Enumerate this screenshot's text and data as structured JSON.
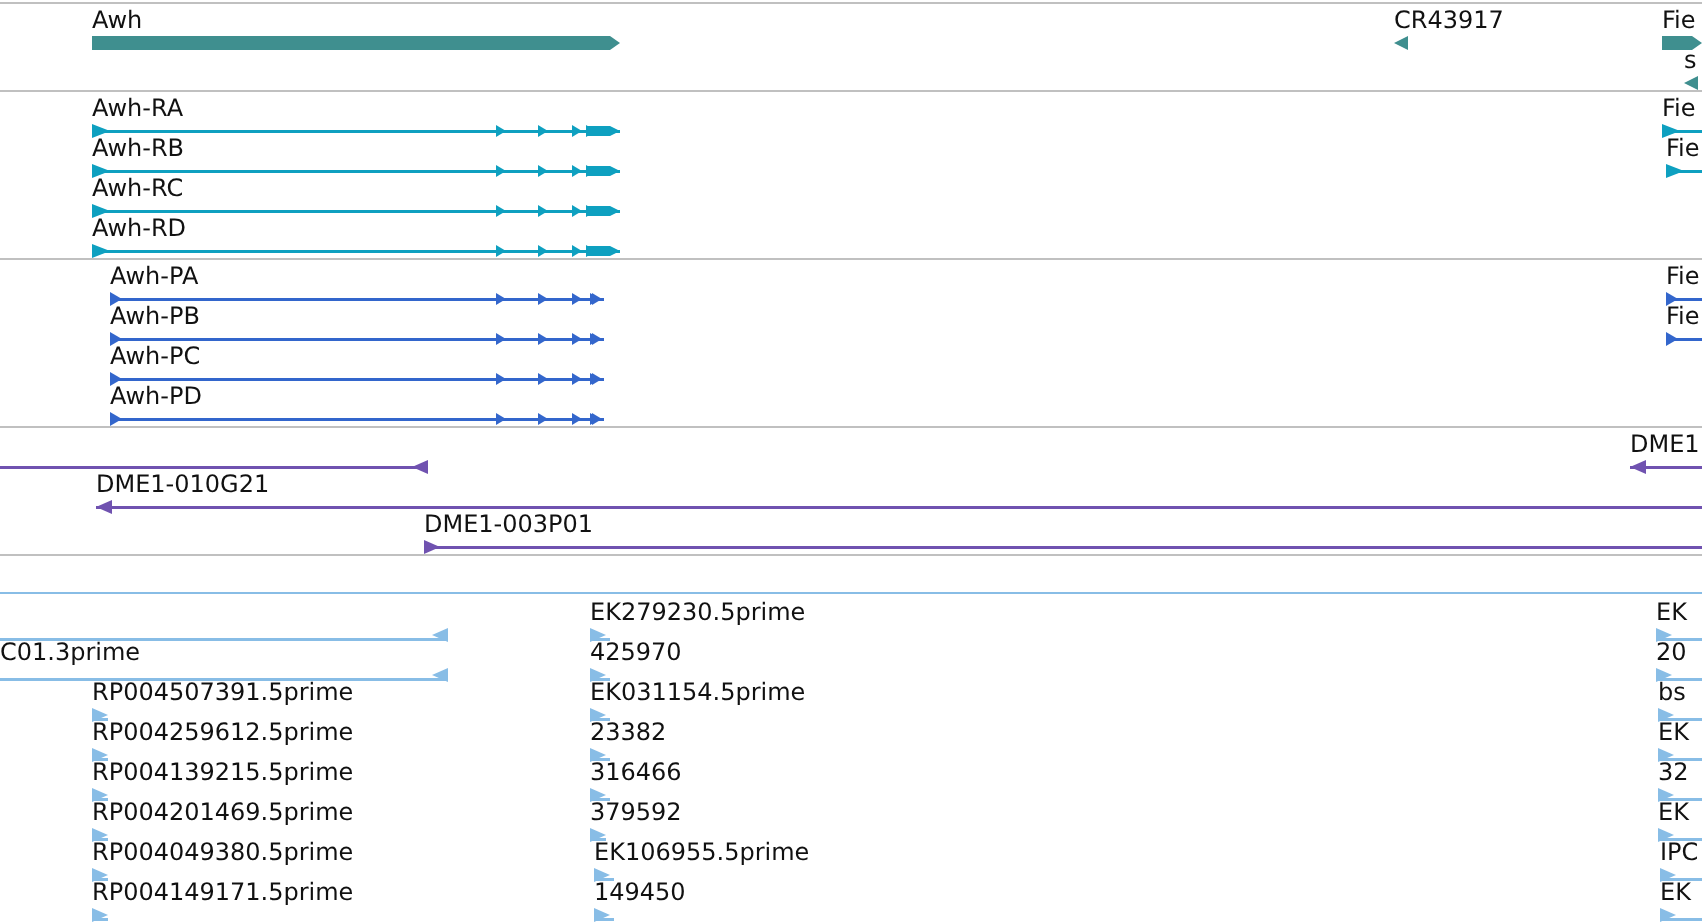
{
  "tracks": [
    {
      "kind": "gene",
      "features": [
        {
          "label": "Awh",
          "reverse": false
        },
        {
          "label": "CR43917",
          "reverse": true
        },
        {
          "label": "Fie",
          "reverse": false
        },
        {
          "label": "s",
          "reverse": true
        }
      ]
    },
    {
      "kind": "transcript",
      "features": [
        {
          "label": "Awh-RA",
          "reverse": false
        },
        {
          "label": "Awh-RB",
          "reverse": false
        },
        {
          "label": "Awh-RC",
          "reverse": false
        },
        {
          "label": "Awh-RD",
          "reverse": false
        },
        {
          "label": "Fie",
          "reverse": false
        },
        {
          "label": "Fie",
          "reverse": false
        }
      ]
    },
    {
      "kind": "protein",
      "features": [
        {
          "label": "Awh-PA",
          "reverse": false
        },
        {
          "label": "Awh-PB",
          "reverse": false
        },
        {
          "label": "Awh-PC",
          "reverse": false
        },
        {
          "label": "Awh-PD",
          "reverse": false
        },
        {
          "label": "Fie",
          "reverse": false
        },
        {
          "label": "Fie",
          "reverse": false
        }
      ]
    },
    {
      "kind": "clone",
      "features": [
        {
          "reverse": true
        },
        {
          "label": "DME1",
          "reverse": true
        },
        {
          "label": "DME1-010G21",
          "reverse": true
        },
        {
          "label": "DME1-003P01",
          "reverse": false
        }
      ]
    },
    {
      "kind": "est",
      "features": [
        {
          "reverse": true
        },
        {
          "label": "C01.3prime",
          "reverse": true
        },
        {
          "label": "RP004507391.5prime",
          "reverse": false
        },
        {
          "label": "RP004259612.5prime",
          "reverse": false
        },
        {
          "label": "RP004139215.5prime",
          "reverse": false
        },
        {
          "label": "RP004201469.5prime",
          "reverse": false
        },
        {
          "label": "RP004049380.5prime",
          "reverse": false
        },
        {
          "label": "RP004149171.5prime",
          "reverse": false
        },
        {
          "label": "EK279230.5prime",
          "reverse": false
        },
        {
          "label": "425970",
          "reverse": false
        },
        {
          "label": "EK031154.5prime",
          "reverse": false
        },
        {
          "label": "23382",
          "reverse": false
        },
        {
          "label": "316466",
          "reverse": false
        },
        {
          "label": "379592",
          "reverse": false
        },
        {
          "label": "EK106955.5prime",
          "reverse": false
        },
        {
          "label": "149450",
          "reverse": false
        },
        {
          "label": "EK",
          "reverse": false
        },
        {
          "label": "20",
          "reverse": false
        },
        {
          "label": "bs",
          "reverse": false
        },
        {
          "label": "EK",
          "reverse": false
        },
        {
          "label": "32",
          "reverse": false
        },
        {
          "label": "EK",
          "reverse": false
        },
        {
          "label": "IPC",
          "reverse": false
        },
        {
          "label": "EK",
          "reverse": false
        }
      ]
    }
  ]
}
